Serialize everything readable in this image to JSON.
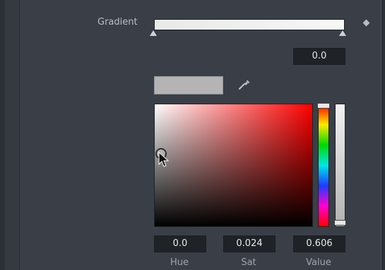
{
  "gradient": {
    "label": "Gradient"
  },
  "position_value": "0.0",
  "color": {
    "swatch": "#b5b3b4"
  },
  "hsv": {
    "hue_value": "0.0",
    "sat_value": "0.024",
    "value_value": "0.606",
    "hue_label": "Hue",
    "sat_label": "Sat",
    "value_label": "Value"
  },
  "icons": [
    "eyedropper-icon",
    "diamond-icon",
    "mouse-pointer-icon"
  ]
}
